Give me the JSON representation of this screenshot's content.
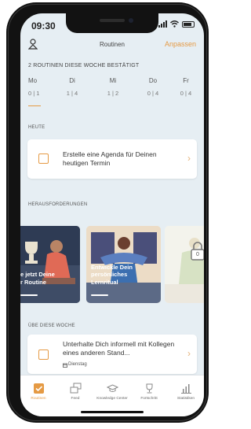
{
  "status_bar": {
    "time": "09:30"
  },
  "header": {
    "title": "Routinen",
    "adjust_label": "Anpassen"
  },
  "week": {
    "heading": "2 ROUTINEN DIESE WOCHE BESTÄTIGT",
    "days": [
      {
        "name": "Mo",
        "count": "0 | 1"
      },
      {
        "name": "Di",
        "count": "1 | 4"
      },
      {
        "name": "Mi",
        "count": "1 | 2"
      },
      {
        "name": "Do",
        "count": "0 | 4"
      },
      {
        "name": "Fr",
        "count": "0 | 4"
      }
    ]
  },
  "today": {
    "section_label": "HEUTE",
    "task": "Erstelle eine Agenda für Deinen heutigen Termin"
  },
  "challenges": {
    "section_label": "HERAUSFORDERUNGEN",
    "tiles": [
      {
        "caption": "e jetzt Deine\nr Routine"
      },
      {
        "caption": "Entwickle Dein\npersönliches\nLernritual"
      },
      {
        "caption": ""
      }
    ],
    "lock_number": "0"
  },
  "this_week": {
    "section_label": "ÜBE DIESE WOCHE",
    "task": "Unterhalte Dich informell mit Kollegen eines anderen Stand...",
    "day": "Dienstag"
  },
  "tabs": [
    {
      "label": "Routinen",
      "active": true
    },
    {
      "label": "Feed",
      "active": false
    },
    {
      "label": "Knowledge Center",
      "active": false
    },
    {
      "label": "Fortschritt",
      "active": false
    },
    {
      "label": "Statistiken",
      "active": false
    }
  ],
  "colors": {
    "accent": "#e59a44",
    "background": "#e6eef3"
  }
}
